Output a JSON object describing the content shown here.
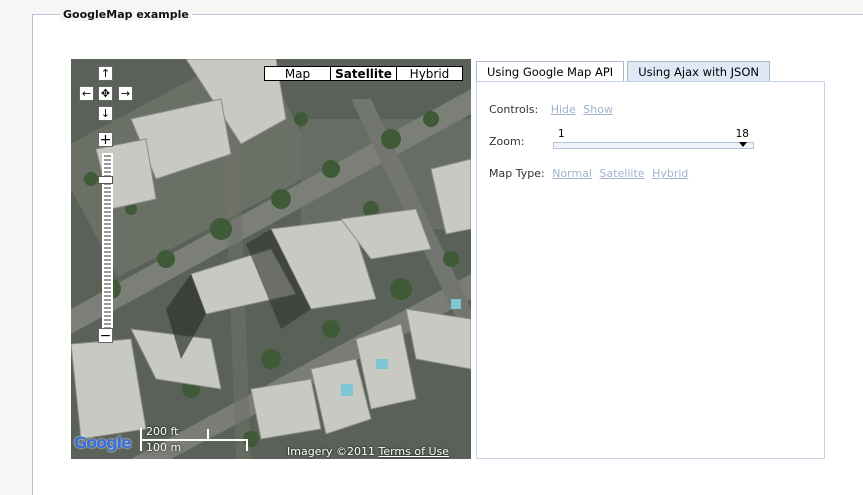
{
  "legend": "GoogleMap example",
  "map": {
    "type_buttons": [
      "Map",
      "Satellite",
      "Hybrid"
    ],
    "active_type": "Satellite",
    "pan": {
      "up": "↑",
      "left": "←",
      "center": "✥",
      "right": "→",
      "down": "↓"
    },
    "zoom_in": "+",
    "zoom_out": "−",
    "logo": "Google",
    "scale_ft": "200 ft",
    "scale_m": "100 m",
    "copyright": "Imagery ©2011 ",
    "terms": "Terms of Use"
  },
  "tabs": [
    "Using Google Map API",
    "Using Ajax with JSON"
  ],
  "active_tab": "Using Google Map API",
  "controls": {
    "label": "Controls:",
    "hide": "Hide",
    "show": "Show"
  },
  "zoom": {
    "label": "Zoom:",
    "min": "1",
    "max": "18",
    "value": 18
  },
  "map_type": {
    "label": "Map Type:",
    "normal": "Normal",
    "satellite": "Satellite",
    "hybrid": "Hybrid"
  },
  "colors": {
    "tab_bg": "#dfe8f5",
    "border": "#aab8cc",
    "link": "#a0b3cc"
  }
}
